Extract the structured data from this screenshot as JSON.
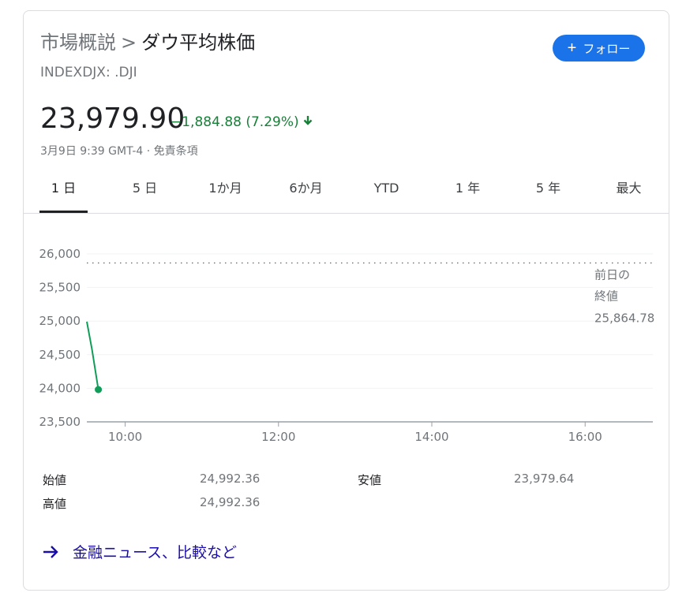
{
  "breadcrumb": {
    "parent": "市場概説",
    "separator": ">",
    "current": "ダウ平均株価"
  },
  "ticker": "INDEXDJX: .DJI",
  "follow_button": {
    "icon": "plus-icon",
    "label": "フォロー"
  },
  "price": "23,979.90",
  "change": {
    "text": "−1,884.88 (7.29%)",
    "direction": "down",
    "icon": "arrow-down-icon"
  },
  "meta": "3月9日 9:39 GMT-4 · 免責条項",
  "tabs": [
    {
      "label": "1 日",
      "active": true
    },
    {
      "label": "5 日"
    },
    {
      "label": "1か月"
    },
    {
      "label": "6か月"
    },
    {
      "label": "YTD"
    },
    {
      "label": "1 年"
    },
    {
      "label": "5 年"
    },
    {
      "label": "最大"
    }
  ],
  "chart_data": {
    "type": "line",
    "ylim": [
      23500,
      26000
    ],
    "yticks": [
      "26,000",
      "25,500",
      "25,000",
      "24,500",
      "24,000",
      "23,500"
    ],
    "xticks": [
      "10:00",
      "12:00",
      "14:00",
      "16:00"
    ],
    "x": [
      "09:30",
      "09:34",
      "09:39"
    ],
    "series": [
      {
        "values": [
          24992.36,
          24580,
          23979.9
        ]
      }
    ],
    "previous_close": {
      "label_line1": "前日の",
      "label_line2": "終値",
      "value": "25,864.78",
      "value_num": 25864.78
    },
    "colors": {
      "line": "#0f9d58",
      "grid": "#f1f3f4",
      "axis": "#9aa0a6",
      "reference": "#5f6368"
    }
  },
  "stats": [
    {
      "label": "始値",
      "value": "24,992.36"
    },
    {
      "label": "高値",
      "value": "24,992.36"
    },
    {
      "label": "安値",
      "value": "23,979.64"
    }
  ],
  "more_link": {
    "icon": "arrow-right-icon",
    "label": "金融ニュース、比較など"
  }
}
